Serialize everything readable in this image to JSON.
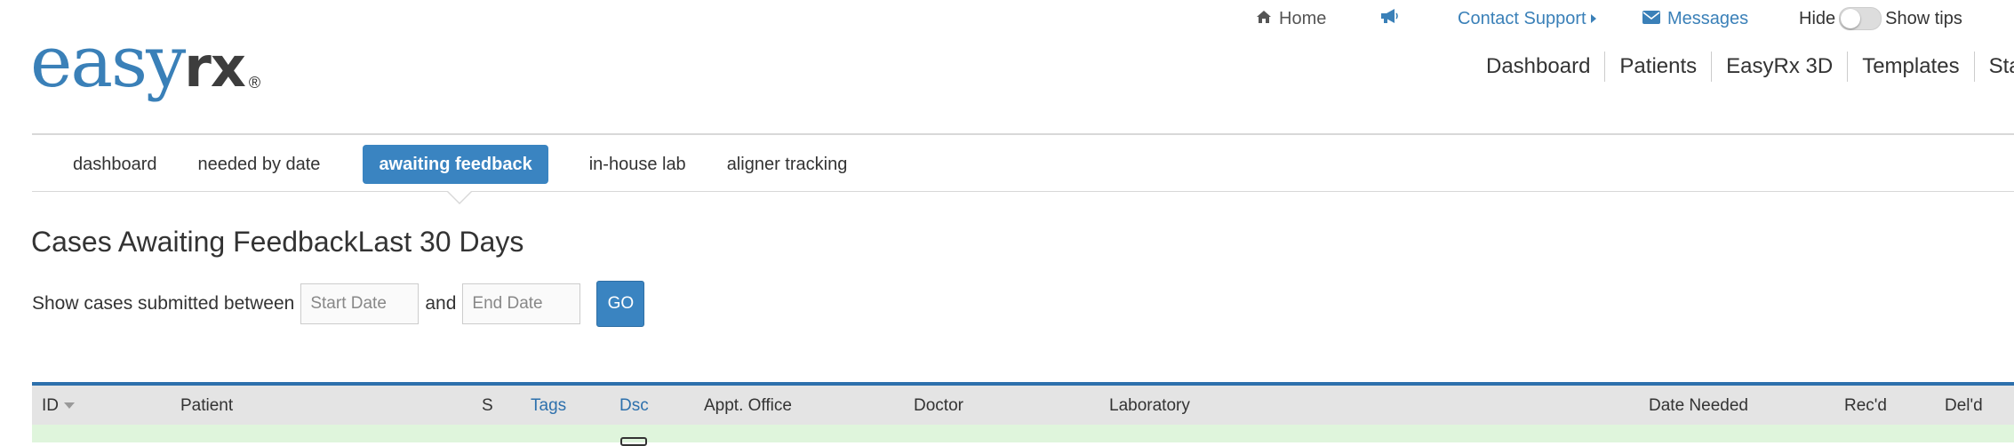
{
  "logo": {
    "part1": "easy",
    "part2": "rx",
    "reg": "®"
  },
  "utility": {
    "home_label": "Home",
    "home_icon": "home-icon",
    "megaphone_icon": "megaphone-icon",
    "contact_label": "Contact Support",
    "messages_label": "Messages",
    "messages_icon": "envelope-icon",
    "hide_label": "Hide",
    "show_tips_label": "Show tips"
  },
  "mainnav": [
    "Dashboard",
    "Patients",
    "EasyRx 3D",
    "Templates",
    "Stats"
  ],
  "subnav": [
    "dashboard",
    "needed by date",
    "awaiting feedback",
    "in-house lab",
    "aligner tracking"
  ],
  "page": {
    "title": "Cases Awaiting FeedbackLast 30 Days"
  },
  "filter": {
    "label": "Show cases submitted between",
    "start_placeholder": "Start Date",
    "and_label": "and",
    "end_placeholder": "End Date",
    "go_label": "GO"
  },
  "table": {
    "columns": [
      "ID",
      "Patient",
      "S",
      "Tags",
      "Dsc",
      "Appt. Office",
      "Doctor",
      "Laboratory",
      "Date Needed",
      "Rec'd",
      "Del'd"
    ]
  },
  "colors": {
    "accent": "#3a84c1",
    "link": "#3a80b8",
    "row_highlight": "#dff5dc"
  }
}
